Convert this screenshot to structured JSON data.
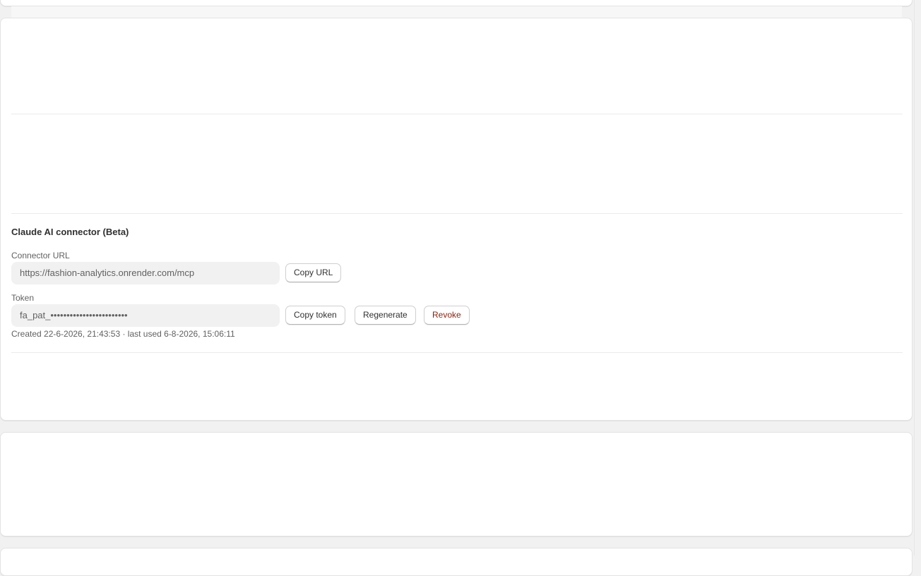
{
  "connector": {
    "title": "Claude AI connector (Beta)",
    "url_label": "Connector URL",
    "url_value": "https://fashion-analytics.onrender.com/mcp",
    "copy_url_label": "Copy URL",
    "token_label": "Token",
    "token_value": "fa_pat_••••••••••••••••••••••••",
    "copy_token_label": "Copy token",
    "regenerate_label": "Regenerate",
    "revoke_label": "Revoke",
    "meta": "Created 22-6-2026, 21:43:53 · last used 6-8-2026, 15:06:11"
  },
  "colors": {
    "page_bg": "#f1f1f1",
    "card_bg": "#ffffff",
    "danger": "#8e1f0b"
  }
}
